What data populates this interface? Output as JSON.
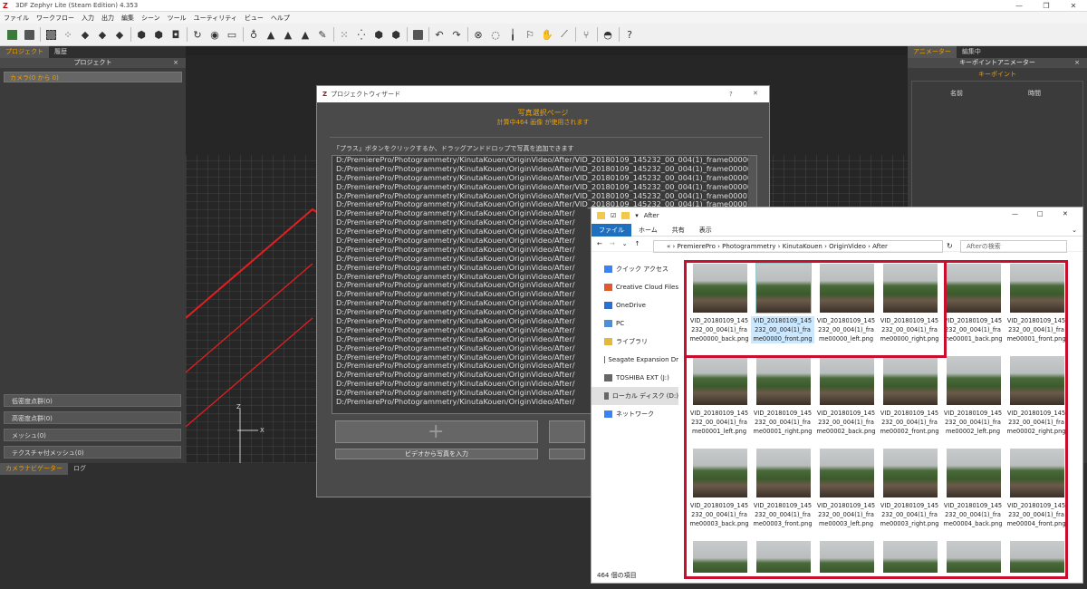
{
  "window": {
    "title": "3DF Zephyr Lite (Steam Edition) 4.353",
    "logo": "Z"
  },
  "menu": [
    "ファイル",
    "ワークフロー",
    "入力",
    "出力",
    "編集",
    "シーン",
    "ツール",
    "ユーティリティ",
    "ビュー",
    "ヘルプ"
  ],
  "left_panel": {
    "tabs": [
      "プロジェクト",
      "履歴"
    ],
    "header": "プロジェクト",
    "camera_row": "カメラ(0 から 0)",
    "items": [
      "低密度点群(0)",
      "高密度点群(0)",
      "メッシュ(0)",
      "テクスチャ付メッシュ(0)"
    ]
  },
  "right_panel": {
    "tabs": [
      "アニメーター",
      "編集中"
    ],
    "header": "キーポイントアニメーター",
    "subheader": "キーポイント",
    "columns": [
      "名前",
      "時間"
    ]
  },
  "bottom_panel": {
    "tabs": [
      "カメラナビゲーター",
      "ログ"
    ]
  },
  "viewport": {
    "axis_z": "Z",
    "axis_x": "X"
  },
  "wizard": {
    "title": "プロジェクトウィザード",
    "help": "?",
    "close": "✕",
    "heading": "写真選択ページ",
    "subheading": "計算中464 画像 が使用されます",
    "instruction": "「プラス」ボタンをクリックするか、ドラッグアンドドロップで写真を追加できます",
    "files": [
      "D:/PremierePro/Photogrammetry/KinutaKouen/OriginVideo/After/VID_20180109_145232_00_004(1)_frame00000_",
      "D:/PremierePro/Photogrammetry/KinutaKouen/OriginVideo/After/VID_20180109_145232_00_004(1)_frame00000_",
      "D:/PremierePro/Photogrammetry/KinutaKouen/OriginVideo/After/VID_20180109_145232_00_004(1)_frame00000_",
      "D:/PremierePro/Photogrammetry/KinutaKouen/OriginVideo/After/VID_20180109_145232_00_004(1)_frame00000_",
      "D:/PremierePro/Photogrammetry/KinutaKouen/OriginVideo/After/VID_20180109_145232_00_004(1)_frame00001_",
      "D:/PremierePro/Photogrammetry/KinutaKouen/OriginVideo/After/VID_20180109_145232_00_004(1)_frame00001_",
      "D:/PremierePro/Photogrammetry/KinutaKouen/OriginVideo/After/",
      "D:/PremierePro/Photogrammetry/KinutaKouen/OriginVideo/After/",
      "D:/PremierePro/Photogrammetry/KinutaKouen/OriginVideo/After/",
      "D:/PremierePro/Photogrammetry/KinutaKouen/OriginVideo/After/",
      "D:/PremierePro/Photogrammetry/KinutaKouen/OriginVideo/After/",
      "D:/PremierePro/Photogrammetry/KinutaKouen/OriginVideo/After/",
      "D:/PremierePro/Photogrammetry/KinutaKouen/OriginVideo/After/",
      "D:/PremierePro/Photogrammetry/KinutaKouen/OriginVideo/After/",
      "D:/PremierePro/Photogrammetry/KinutaKouen/OriginVideo/After/",
      "D:/PremierePro/Photogrammetry/KinutaKouen/OriginVideo/After/",
      "D:/PremierePro/Photogrammetry/KinutaKouen/OriginVideo/After/",
      "D:/PremierePro/Photogrammetry/KinutaKouen/OriginVideo/After/",
      "D:/PremierePro/Photogrammetry/KinutaKouen/OriginVideo/After/",
      "D:/PremierePro/Photogrammetry/KinutaKouen/OriginVideo/After/",
      "D:/PremierePro/Photogrammetry/KinutaKouen/OriginVideo/After/",
      "D:/PremierePro/Photogrammetry/KinutaKouen/OriginVideo/After/",
      "D:/PremierePro/Photogrammetry/KinutaKouen/OriginVideo/After/",
      "D:/PremierePro/Photogrammetry/KinutaKouen/OriginVideo/After/",
      "D:/PremierePro/Photogrammetry/KinutaKouen/OriginVideo/After/",
      "D:/PremierePro/Photogrammetry/KinutaKouen/OriginVideo/After/",
      "D:/PremierePro/Photogrammetry/KinutaKouen/OriginVideo/After/",
      "D:/PremierePro/Photogrammetry/KinutaKouen/OriginVideo/After/"
    ],
    "plus_label": "+",
    "video_button": "ビデオから写真を入力"
  },
  "explorer": {
    "title": "After",
    "ribbon": [
      "ファイル",
      "ホーム",
      "共有",
      "表示"
    ],
    "breadcrumb": [
      "PremierePro",
      "Photogrammetry",
      "KinutaKouen",
      "OriginVideo",
      "After"
    ],
    "breadcrumb_prefix": "«",
    "search_placeholder": "Afterの検索",
    "nav": [
      "クイック アクセス",
      "Creative Cloud Files",
      "OneDrive",
      "PC",
      "ライブラリ",
      "Seagate Expansion Dr",
      "TOSHIBA EXT (J:)",
      "ローカル ディスク (D:)",
      "ネットワーク"
    ],
    "nav_selected": 7,
    "files": [
      "VID_20180109_145232_00_004(1)_frame00000_back.png",
      "VID_20180109_145232_00_004(1)_frame00000_front.png",
      "VID_20180109_145232_00_004(1)_frame00000_left.png",
      "VID_20180109_145232_00_004(1)_frame00000_right.png",
      "VID_20180109_145232_00_004(1)_frame00001_back.png",
      "VID_20180109_145232_00_004(1)_frame00001_front.png",
      "VID_20180109_145232_00_004(1)_frame00001_left.png",
      "VID_20180109_145232_00_004(1)_frame00001_right.png",
      "VID_20180109_145232_00_004(1)_frame00002_back.png",
      "VID_20180109_145232_00_004(1)_frame00002_front.png",
      "VID_20180109_145232_00_004(1)_frame00002_left.png",
      "VID_20180109_145232_00_004(1)_frame00002_right.png",
      "VID_20180109_145232_00_004(1)_frame00003_back.png",
      "VID_20180109_145232_00_004(1)_frame00003_front.png",
      "VID_20180109_145232_00_004(1)_frame00003_left.png",
      "VID_20180109_145232_00_004(1)_frame00003_right.png",
      "VID_20180109_145232_00_004(1)_frame00004_back.png",
      "VID_20180109_145232_00_004(1)_frame00004_front.png",
      "",
      "",
      "",
      "",
      "",
      ""
    ],
    "selected_index": 1,
    "status": "464 個の項目",
    "highlight_color": "#c8102e"
  }
}
